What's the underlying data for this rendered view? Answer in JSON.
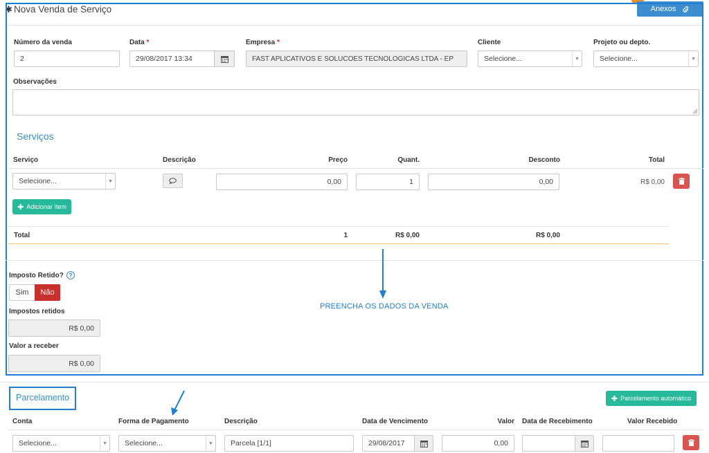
{
  "header": {
    "title": "Nova Venda de Serviço",
    "anexos_label": "Anexos"
  },
  "form": {
    "numero_label": "Número da venda",
    "numero_value": "2",
    "data_label": "Data",
    "data_value": "29/08/2017 13:34",
    "empresa_label": "Empresa",
    "empresa_value": "FAST APLICATIVOS E SOLUCOES TECNOLOGICAS LTDA - EP",
    "cliente_label": "Cliente",
    "cliente_value": "Selecione...",
    "projeto_label": "Projeto ou depto.",
    "projeto_value": "Selecione...",
    "obs_label": "Observações",
    "required_mark": "*"
  },
  "servicos": {
    "title": "Serviços",
    "columns": {
      "servico": "Serviço",
      "descricao": "Descrição",
      "preco": "Preço",
      "quant": "Quant.",
      "desconto": "Desconto",
      "total": "Total"
    },
    "row": {
      "servico": "Selecione...",
      "preco": "0,00",
      "quant": "1",
      "desconto": "0,00",
      "total": "R$ 0,00"
    },
    "add_label": "Adicionar Item",
    "totals": {
      "label": "Total",
      "quant": "1",
      "preco": "R$ 0,00",
      "desconto": "R$ 0,00"
    }
  },
  "impostos": {
    "retido_label": "Imposto Retido?",
    "sim": "Sim",
    "nao": "Não",
    "retidos_label": "Impostos retidos",
    "retidos_value": "R$ 0,00",
    "receber_label": "Valor a receber",
    "receber_value": "R$ 0,00"
  },
  "annotation": {
    "text": "PREENCHA OS DADOS DA VENDA"
  },
  "parcelamento": {
    "title": "Parcelamento",
    "auto_label": "Parcelamento automático",
    "columns": {
      "conta": "Conta",
      "forma": "Forma de Pagamento",
      "descricao": "Descrição",
      "vencimento": "Data de Vencimento",
      "valor": "Valor",
      "recebimento": "Data de Recebimento",
      "recebido": "Valor Recebido"
    },
    "row": {
      "conta": "Selecione...",
      "forma": "Selecione...",
      "descricao": "Parcela [1/1]",
      "vencimento": "29/08/2017",
      "valor": "0,00"
    }
  },
  "colors": {
    "highlight": "#1e7fd6",
    "green": "#26b99a",
    "red": "#d9534f",
    "title_blue": "#3a8fc5"
  }
}
